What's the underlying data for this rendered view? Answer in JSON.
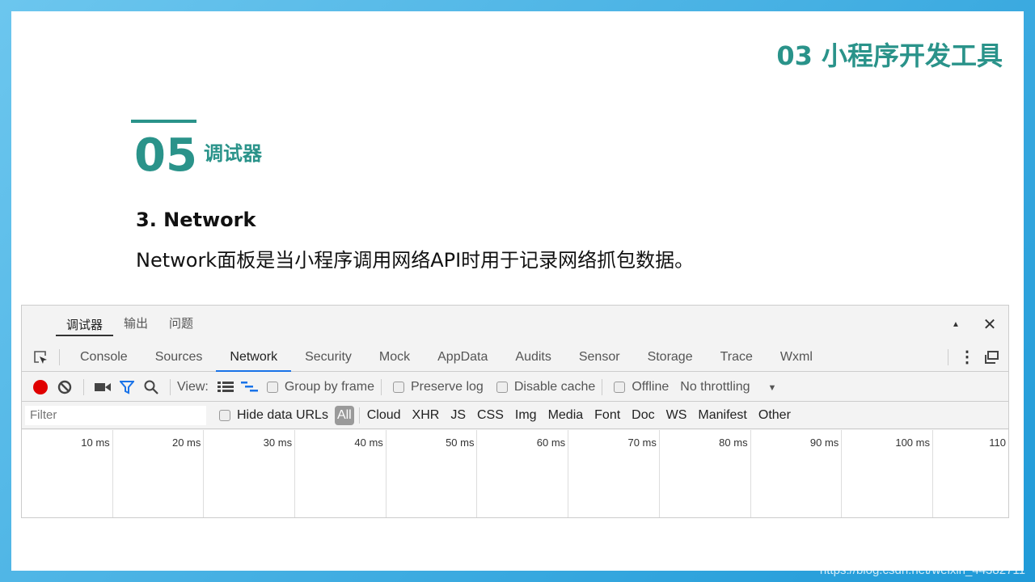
{
  "slide": {
    "title": "03 小程序开发工具",
    "section_number": "05",
    "section_title": "调试器",
    "heading": "3. Network",
    "description": "Network面板是当小程序调用网络API时用于记录网络抓包数据。"
  },
  "devtools": {
    "top_tabs": [
      "调试器",
      "输出",
      "问题"
    ],
    "panel_tabs": [
      "Console",
      "Sources",
      "Network",
      "Security",
      "Mock",
      "AppData",
      "Audits",
      "Sensor",
      "Storage",
      "Trace",
      "Wxml"
    ],
    "active_panel": "Network",
    "toolbar": {
      "view_label": "View:",
      "group_by_frame": "Group by frame",
      "preserve_log": "Preserve log",
      "disable_cache": "Disable cache",
      "offline": "Offline",
      "throttling": "No throttling"
    },
    "filter": {
      "placeholder": "Filter",
      "hide_data_urls": "Hide data URLs",
      "types": [
        "All",
        "Cloud",
        "XHR",
        "JS",
        "CSS",
        "Img",
        "Media",
        "Font",
        "Doc",
        "WS",
        "Manifest",
        "Other"
      ]
    },
    "timeline_ticks": [
      "10 ms",
      "20 ms",
      "30 ms",
      "40 ms",
      "50 ms",
      "60 ms",
      "70 ms",
      "80 ms",
      "90 ms",
      "100 ms",
      "110"
    ],
    "colors": {
      "record": "#e00000",
      "accent": "#1a73e8"
    }
  },
  "watermark": "https://blog.csdn.net/weixin_44382711"
}
